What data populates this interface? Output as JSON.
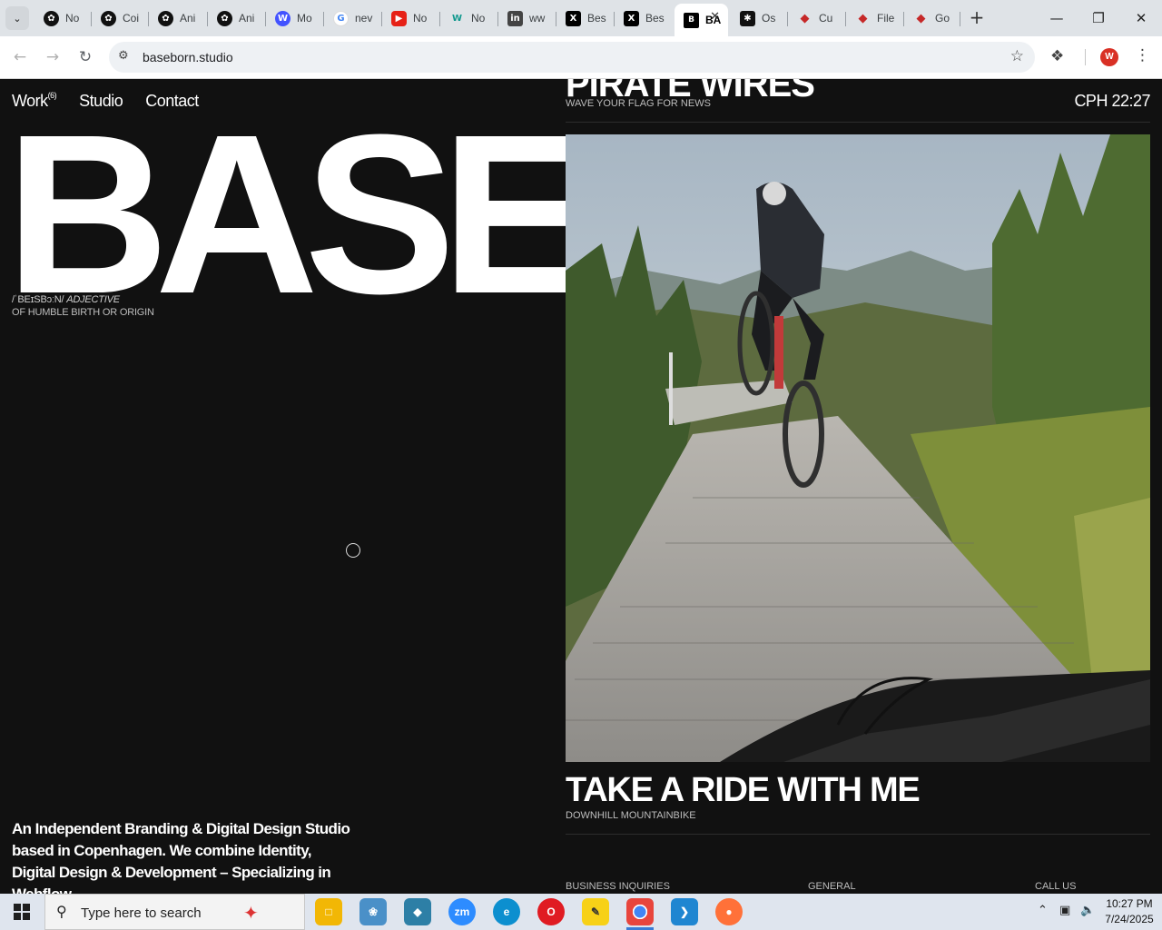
{
  "browser": {
    "tabs": [
      {
        "label": "No",
        "icon": "notion-icon",
        "color": "#111111"
      },
      {
        "label": "Coi",
        "icon": "chatgpt-icon",
        "color": "#111111"
      },
      {
        "label": "Ani",
        "icon": "chatgpt-icon",
        "color": "#111111"
      },
      {
        "label": "Ani",
        "icon": "chatgpt-icon",
        "color": "#111111"
      },
      {
        "label": "Mo",
        "icon": "webflow-icon",
        "color": "#4353ff"
      },
      {
        "label": "nev",
        "icon": "google-icon",
        "color": "#4285f4"
      },
      {
        "label": "No",
        "icon": "youtube-icon",
        "color": "#e62117"
      },
      {
        "label": "No",
        "icon": "w-logo-icon",
        "color": "#11998e"
      },
      {
        "label": "ww",
        "icon": "linkedin-icon",
        "color": "#0a66c2"
      },
      {
        "label": "Bes",
        "icon": "x-icon",
        "color": "#000000"
      },
      {
        "label": "Bes",
        "icon": "x-icon",
        "color": "#000000"
      },
      {
        "label": "BA",
        "icon": "baseborn-icon",
        "color": "#000000",
        "active": true
      },
      {
        "label": "Os",
        "icon": "asterisk-icon",
        "color": "#111111"
      },
      {
        "label": "Cu",
        "icon": "gem-icon",
        "color": "#c62828"
      },
      {
        "label": "File",
        "icon": "gem-icon",
        "color": "#c62828"
      },
      {
        "label": "Go",
        "icon": "gem-icon",
        "color": "#c62828"
      }
    ],
    "url": "baseborn.studio",
    "profile_initial": "W"
  },
  "site": {
    "nav": {
      "work": "Work",
      "work_count": "(6)",
      "studio": "Studio",
      "contact": "Contact"
    },
    "clock": "CPH 22:27",
    "hero_word": "BASE",
    "phonetic": "/ˈBEɪSBɔːN/",
    "part_of_speech": "ADJECTIVE",
    "definition": "OF HUMBLE BIRTH OR ORIGIN",
    "about": "An Independent Branding & Digital Design Studio based in Copenhagen. We combine Identity, Digital Design & Development – Specializing in Webflow.",
    "prev_project": {
      "title": "PIRATE WIRES",
      "subtitle": "WAVE YOUR FLAG FOR NEWS"
    },
    "project": {
      "title": "TAKE A RIDE WITH ME",
      "subtitle": "DOWNHILL MOUNTAINBIKE"
    },
    "footer": {
      "business": "BUSINESS INQUIRIES",
      "general": "GENERAL",
      "call": "CALL US"
    }
  },
  "taskbar": {
    "search_placeholder": "Type here to search",
    "time": "10:27 PM",
    "date": "7/24/2025",
    "apps": [
      {
        "name": "file-explorer-icon",
        "color": "#f2b705"
      },
      {
        "name": "paint-app-icon",
        "color": "#4a90c8"
      },
      {
        "name": "gem-app-icon",
        "color": "#2d7fa6"
      },
      {
        "name": "zoom-icon",
        "color": "#2d8cff",
        "label": "zm"
      },
      {
        "name": "edge-icon",
        "color": "#0c8fcf"
      },
      {
        "name": "opera-icon",
        "color": "#e01b22"
      },
      {
        "name": "sticky-notes-icon",
        "color": "#f7d117"
      },
      {
        "name": "chrome-icon",
        "color": "#e8453c",
        "active": true
      },
      {
        "name": "vscode-icon",
        "color": "#1f86d1"
      },
      {
        "name": "firefox-icon",
        "color": "#ff7139"
      }
    ]
  }
}
